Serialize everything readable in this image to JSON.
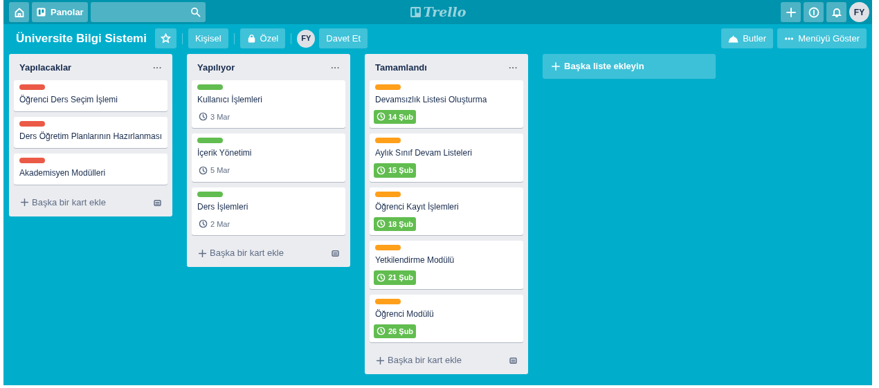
{
  "header": {
    "boards_button": "Panolar",
    "logo": "Trello",
    "avatar": "FY"
  },
  "board": {
    "title": "Üniversite Bilgi Sistemi",
    "starred": false,
    "team_button": "Kişisel",
    "visibility_button": "Özel",
    "member_avatar": "FY",
    "invite_button": "Davet Et",
    "butler_button": "Butler",
    "menu_button": "Menüyü Göster"
  },
  "lists": [
    {
      "title": "Yapılacaklar",
      "menu": "···",
      "add_card": "Başka bir kart ekle",
      "cards": [
        {
          "title": "Öğrenci Ders Seçim İşlemi",
          "color": "#eb5a46"
        },
        {
          "title": "Ders Öğretim Planlarının Hazırlanması",
          "color": "#eb5a46"
        },
        {
          "title": "Akademisyen Modülleri",
          "color": "#eb5a46"
        }
      ]
    },
    {
      "title": "Yapılıyor",
      "menu": "···",
      "add_card": "Başka bir kart ekle",
      "cards": [
        {
          "title": "Kullanıcı İşlemleri",
          "color": "#61bd4f",
          "due": "3 Mar",
          "due_complete": false
        },
        {
          "title": "İçerik Yönetimi",
          "color": "#61bd4f",
          "due": "5 Mar",
          "due_complete": false
        },
        {
          "title": "Ders İşlemleri",
          "color": "#61bd4f",
          "due": "2 Mar",
          "due_complete": false
        }
      ]
    },
    {
      "title": "Tamamlandı",
      "menu": "···",
      "add_card": "Başka bir kart ekle",
      "cards": [
        {
          "title": "Devamsızlık Listesi Oluşturma",
          "color": "#ff9f1a",
          "due": "14 Şub",
          "due_complete": true
        },
        {
          "title": "Aylık Sınıf Devam Listeleri",
          "color": "#ff9f1a",
          "due": "15 Şub",
          "due_complete": true
        },
        {
          "title": "Öğrenci Kayıt İşlemleri",
          "color": "#ff9f1a",
          "due": "18 Şub",
          "due_complete": true
        },
        {
          "title": "Yetkilendirme Modülü",
          "color": "#ff9f1a",
          "due": "21 Şub",
          "due_complete": true
        },
        {
          "title": "Öğrenci Modülü",
          "color": "#ff9f1a",
          "due": "26 Şub",
          "due_complete": true
        }
      ]
    }
  ],
  "add_list": "Başka liste ekleyin"
}
